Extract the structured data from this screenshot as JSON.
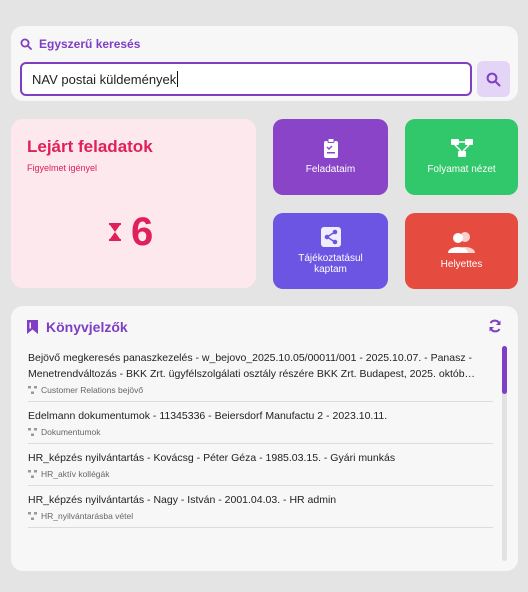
{
  "search": {
    "title": "Egyszerű keresés",
    "value": "NAV postai küldemények"
  },
  "expired": {
    "title": "Lejárt feladatok",
    "subtitle": "Figyelmet igényel",
    "count": "6"
  },
  "tiles": [
    {
      "label": "Feladataim",
      "icon": "clipboard-icon",
      "color": "#8a44c8"
    },
    {
      "label": "Folyamat nézet",
      "icon": "flow-icon",
      "color": "#31c76b"
    },
    {
      "label": "Tájékoztatásul kaptam",
      "icon": "share-icon",
      "color": "#6c55e2"
    },
    {
      "label": "Helyettes",
      "icon": "users-icon",
      "color": "#e64b40"
    }
  ],
  "bookmarks": {
    "title": "Könyvjelzők",
    "items": [
      {
        "text": "Bejövő megkeresés panaszkezelés - w_bejovo_2025.10.05/00011/001 - 2025.10.07. - Panasz - Menetrendváltozás - BKK Zrt. ügyfélszolgálati osztály részére BKK Zrt. Budapest, 2025. októb…",
        "tag": "Customer Relations bejövő"
      },
      {
        "text": "Edelmann dokumentumok - 11345336 - Beiersdorf Manufactu 2 - 2023.10.11.",
        "tag": "Dokumentumok"
      },
      {
        "text": "HR_képzés nyilvántartás - Kovácsg - Péter Géza - 1985.03.15. - Gyári munkás",
        "tag": "HR_aktív kollégák"
      },
      {
        "text": "HR_képzés nyilvántartás - Nagy - István - 2001.04.03. - HR admin",
        "tag": "HR_nyilvántarásba vétel"
      }
    ]
  },
  "colors": {
    "accent": "#7e3fc4",
    "alert": "#e0205a"
  }
}
